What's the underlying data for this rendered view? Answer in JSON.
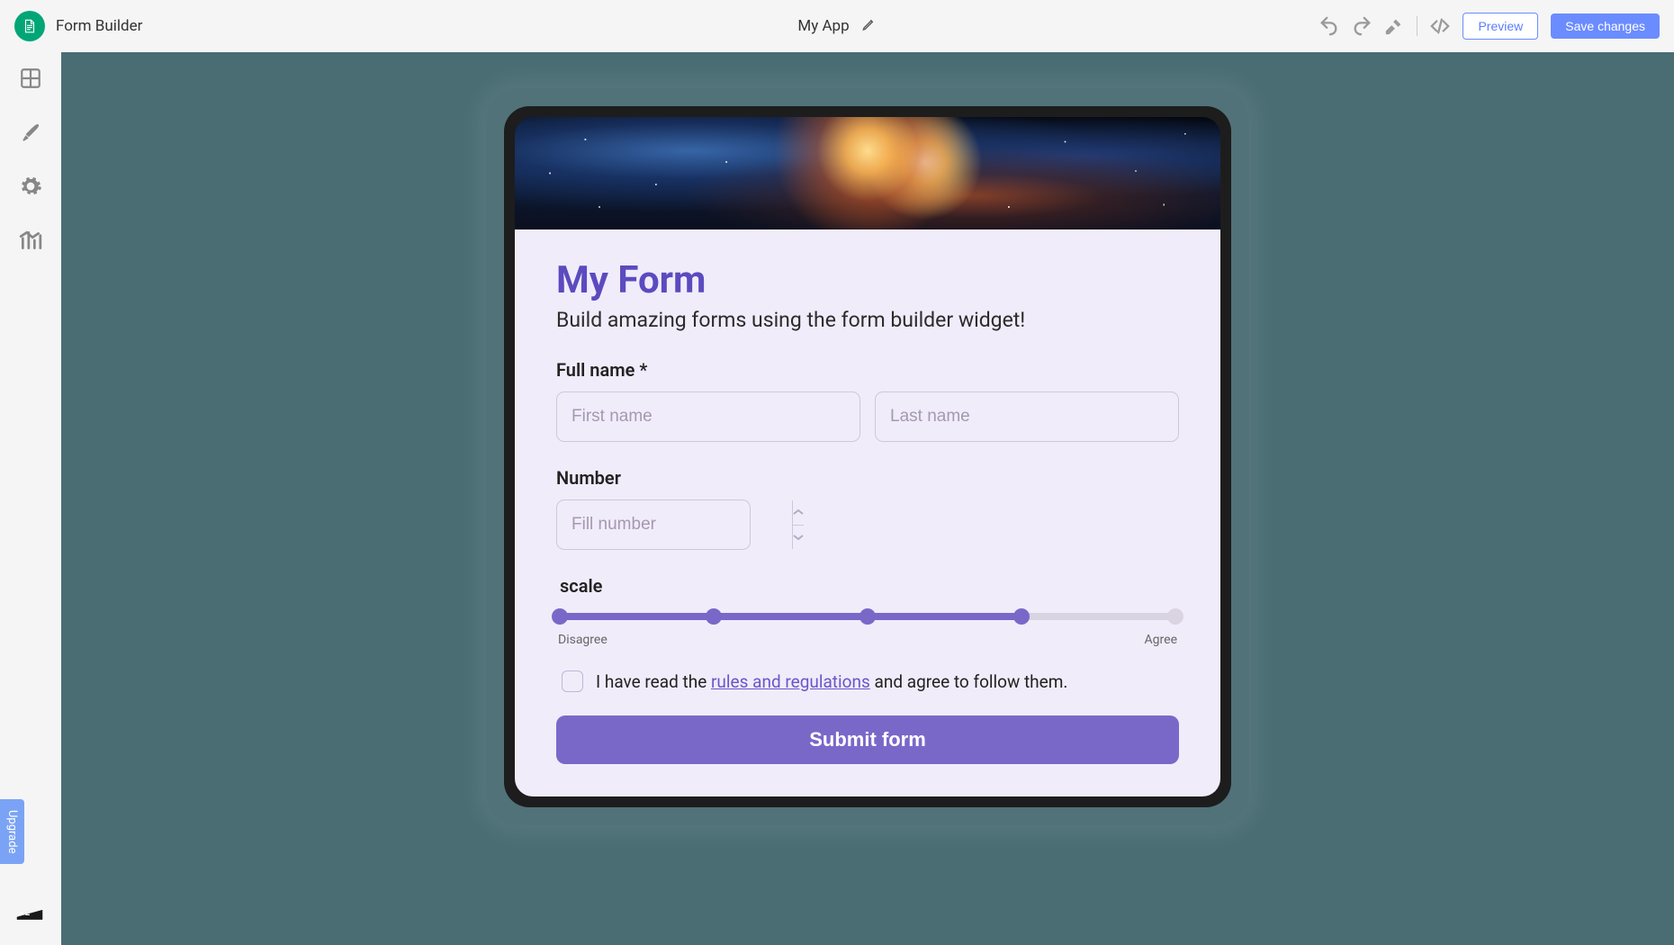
{
  "header": {
    "app_label": "Form Builder",
    "app_name": "My App",
    "preview_label": "Preview",
    "save_label": "Save changes"
  },
  "sidebar": {
    "upgrade_label": "Upgrade"
  },
  "form": {
    "title": "My Form",
    "subtitle": "Build amazing forms using the form builder widget!",
    "fullname_label": "Full name *",
    "first_placeholder": "First name",
    "last_placeholder": "Last name",
    "number_label": "Number",
    "number_placeholder": "Fill number",
    "scale_label": "scale",
    "scale_lo": "Disagree",
    "scale_hi": "Agree",
    "consent_prefix": "I have read the ",
    "consent_link": "rules and regulations",
    "consent_suffix": " and agree to follow them.",
    "submit_label": "Submit form"
  },
  "colors": {
    "accent": "#7a68c9",
    "header_accent": "#6b8cff"
  }
}
